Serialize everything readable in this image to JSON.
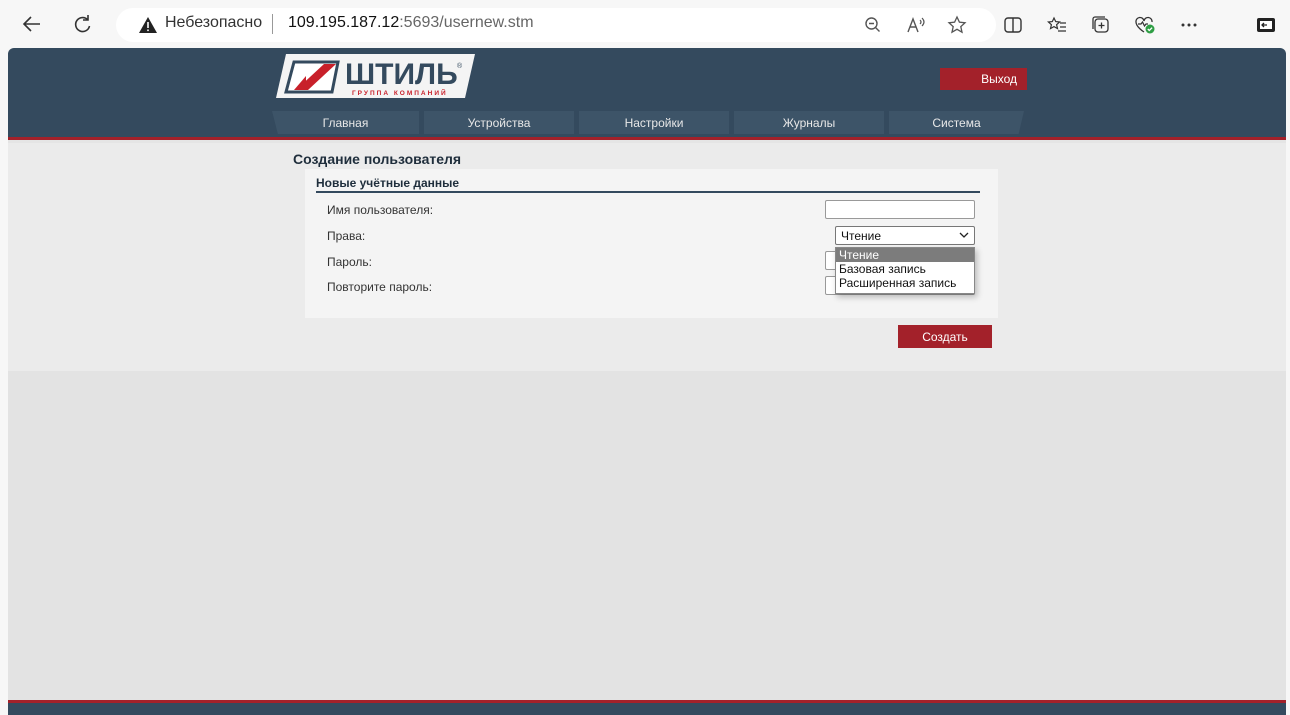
{
  "browser": {
    "insecure_label": "Небезопасно",
    "url_host": "109.195.187.12",
    "url_rest": ":5693/usernew.stm"
  },
  "header": {
    "logo_text": "ШТИЛЬ",
    "logo_subtitle": "ГРУППА КОМПАНИЙ",
    "logout_label": "Выход"
  },
  "tabs": [
    {
      "label": "Главная"
    },
    {
      "label": "Устройства"
    },
    {
      "label": "Настройки"
    },
    {
      "label": "Журналы"
    },
    {
      "label": "Система"
    }
  ],
  "form": {
    "page_title": "Создание пользователя",
    "section_title": "Новые учётные данные",
    "username_label": "Имя пользователя:",
    "username_value": "",
    "rights_label": "Права:",
    "rights_value": "Чтение",
    "rights_options": [
      "Чтение",
      "Базовая запись",
      "Расширенная запись"
    ],
    "password_label": "Пароль:",
    "repeat_password_label": "Повторите пароль:",
    "create_label": "Создать"
  },
  "colors": {
    "header_bg": "#344a5e",
    "accent_red": "#a3212a"
  }
}
